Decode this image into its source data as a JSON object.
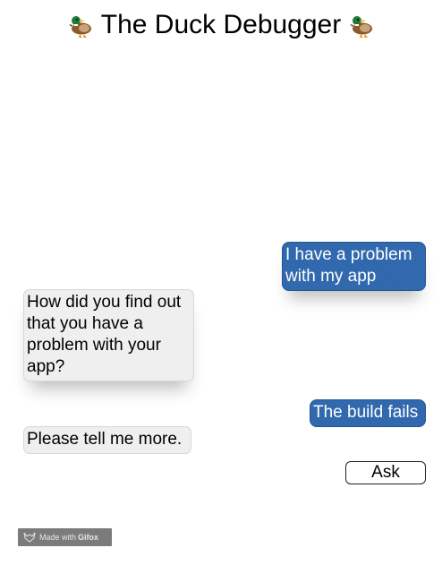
{
  "header": {
    "title": "The Duck Debugger",
    "left_icon": "duck-icon",
    "right_icon": "duck-icon"
  },
  "conversation": {
    "messages": [
      {
        "sender": "user",
        "text": "I have a problem with my app"
      },
      {
        "sender": "duck",
        "text": "How did you find out that you have a problem with your app?"
      },
      {
        "sender": "user",
        "text": "The build fails"
      },
      {
        "sender": "duck",
        "text": "Please tell me more."
      }
    ]
  },
  "controls": {
    "ask_label": "Ask"
  },
  "watermark": {
    "prefix": "Made with",
    "brand": "Gifox",
    "icon": "fox-icon"
  },
  "colors": {
    "user_bubble": "#2f67ad",
    "duck_bubble": "#efefef",
    "background": "#ffffff"
  }
}
